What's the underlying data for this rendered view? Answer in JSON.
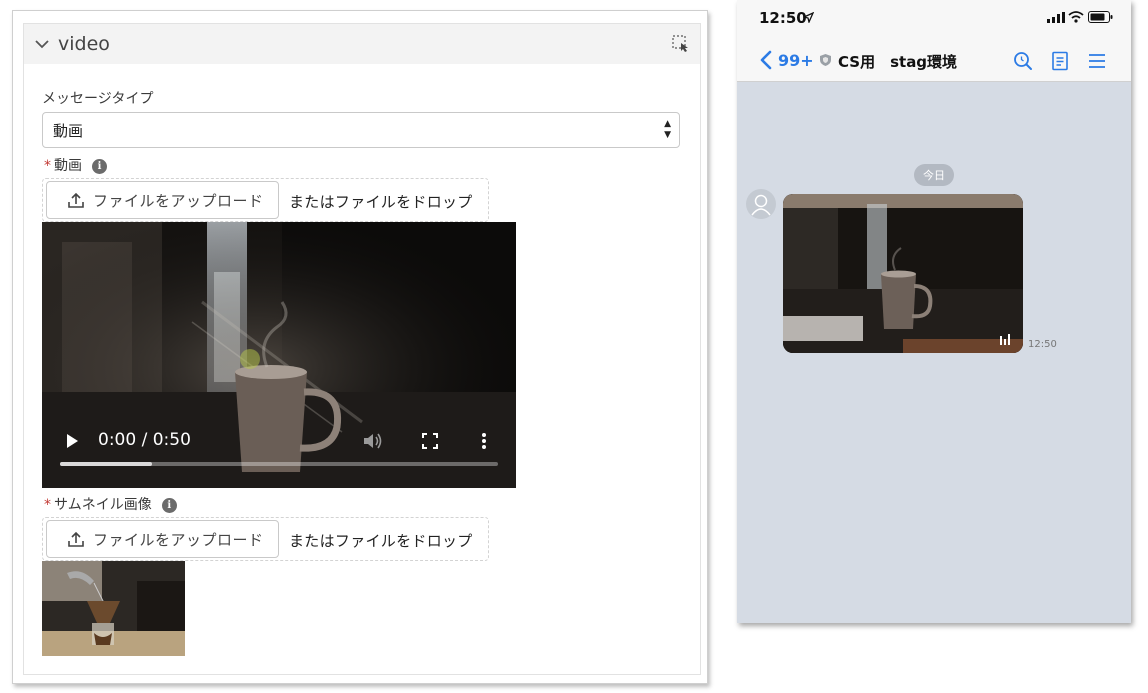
{
  "left": {
    "section_title": "video",
    "message_type_label": "メッセージタイプ",
    "message_type_value": "動画",
    "video_label": "動画",
    "thumbnail_label": "サムネイル画像",
    "required_mark": "*",
    "info_glyph": "i",
    "upload_button_label": "ファイルをアップロード",
    "drop_text": "またはファイルをドロップ",
    "player": {
      "time_display": "0:00 / 0:50",
      "progress_fraction": 0.21
    },
    "icons": [
      "chevron-down-icon",
      "select-tool-icon",
      "upload-icon",
      "info-icon",
      "play-icon",
      "volume-icon",
      "fullscreen-icon",
      "more-vert-icon"
    ]
  },
  "phone": {
    "status_time": "12:50",
    "back_count": "99+",
    "chat_title": "CS用　stag環境",
    "date_label": "今日",
    "message_time": "12:50",
    "accent_color": "#2c7be5",
    "icons": [
      "location-arrow-icon",
      "signal-icon",
      "wifi-icon",
      "battery-icon",
      "back-chevron-icon",
      "shield-icon",
      "search-icon",
      "notes-icon",
      "menu-icon",
      "avatar-icon",
      "stats-icon"
    ]
  }
}
